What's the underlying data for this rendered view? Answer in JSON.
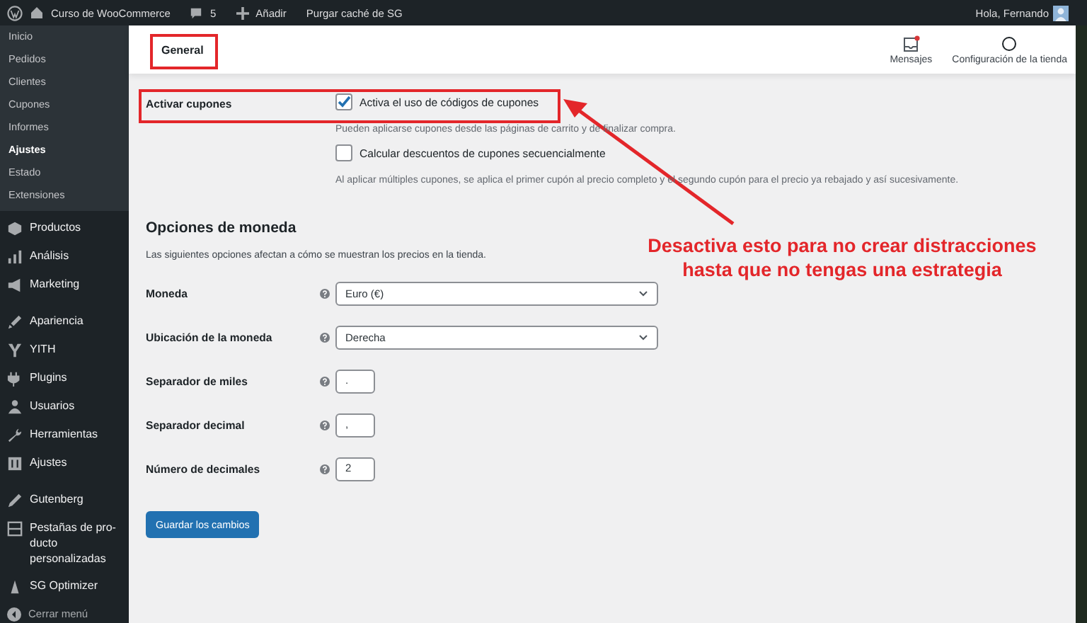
{
  "admin_bar": {
    "site": "Curso de WooCommerce",
    "comments": "5",
    "add": "Añadir",
    "purge": "Purgar caché de SG",
    "greeting": "Hola, Fernando"
  },
  "sidebar": {
    "submenu": [
      {
        "label": "Inicio",
        "selected": false
      },
      {
        "label": "Pedidos",
        "selected": false
      },
      {
        "label": "Clientes",
        "selected": false
      },
      {
        "label": "Cupones",
        "selected": false
      },
      {
        "label": "Informes",
        "selected": false
      },
      {
        "label": "Ajustes",
        "selected": true
      },
      {
        "label": "Estado",
        "selected": false
      },
      {
        "label": "Extensiones",
        "selected": false
      }
    ],
    "menu": [
      {
        "label": "Productos"
      },
      {
        "label": "Análisis"
      },
      {
        "label": "Marketing"
      },
      {
        "label": "Apariencia"
      },
      {
        "label": "YITH"
      },
      {
        "label": "Plugins"
      },
      {
        "label": "Usuarios"
      },
      {
        "label": "Herramientas"
      },
      {
        "label": "Ajustes"
      },
      {
        "label": "Gutenberg"
      },
      {
        "label": "Pestañas de pro-ducto personalizadas"
      },
      {
        "label": "SG Optimizer"
      }
    ],
    "close_menu": "Cerrar menú"
  },
  "header": {
    "tabs": [
      {
        "label": "General",
        "selected": true
      }
    ],
    "actions": [
      {
        "label": "Mensajes",
        "unread": true
      },
      {
        "label": "Configuración de la tienda",
        "unread": false
      }
    ]
  },
  "coupons": {
    "label": "Activar cupones",
    "options": [
      {
        "label": "Activa el uso de códigos de cupones",
        "checked": true,
        "description": "Pueden aplicarse cupones desde las páginas de carrito y de finalizar compra."
      },
      {
        "label": "Calcular descuentos de cupones secuencialmente",
        "checked": false,
        "description": "Al aplicar múltiples cupones, se aplica el primer cupón al precio completo y el segundo cupón para el precio ya rebajado y así sucesivamente."
      }
    ]
  },
  "currency": {
    "title": "Opciones de moneda",
    "description": "Las siguientes opciones afectan a cómo se muestran los precios en la tienda.",
    "fields": [
      {
        "label": "Moneda",
        "kind": "select",
        "value": "Euro (€)"
      },
      {
        "label": "Ubicación de la moneda",
        "kind": "select",
        "value": "Derecha"
      },
      {
        "label": "Separador de miles",
        "kind": "text",
        "value": "."
      },
      {
        "label": "Separador decimal",
        "kind": "text",
        "value": ","
      },
      {
        "label": "Número de decimales",
        "kind": "text",
        "value": "2"
      }
    ]
  },
  "save_button": "Guardar los cambios",
  "annotation": {
    "text": "Desactiva esto para no crear distracciones hasta que no tengas una estrategia"
  }
}
